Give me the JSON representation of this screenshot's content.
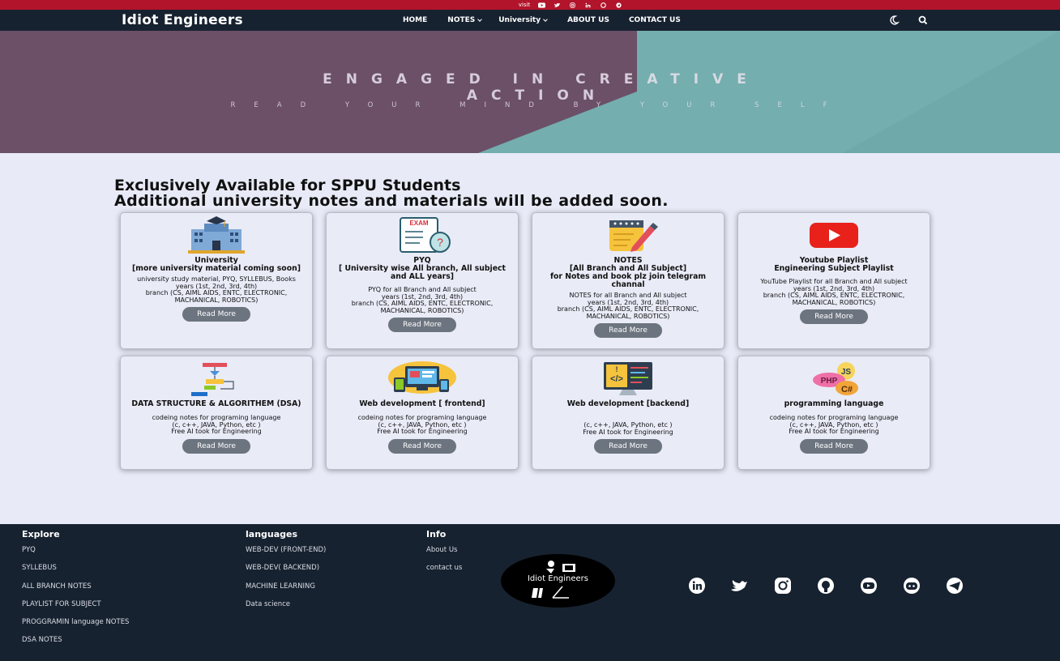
{
  "topbar": {
    "visit_label": "visit",
    "icons": [
      "youtube-icon",
      "twitter-icon",
      "instagram-icon",
      "linkedin-icon",
      "github-icon",
      "telegram-icon"
    ]
  },
  "nav": {
    "brand": "Idiot Engineers",
    "items": [
      {
        "label": "HOME",
        "dropdown": false
      },
      {
        "label": "NOTES",
        "dropdown": true
      },
      {
        "label": "University",
        "dropdown": true
      },
      {
        "label": "ABOUT US",
        "dropdown": false
      },
      {
        "label": "CONTACT US",
        "dropdown": false
      }
    ],
    "icons": [
      "moon-icon",
      "search-icon"
    ]
  },
  "hero": {
    "title_line1": "ENGAGED IN CREATIVE",
    "title_line2": "ACTION",
    "subtitle": "READ YOUR MIND BY YOUR SELF"
  },
  "heading": {
    "line1": "Exclusively Available for SPPU Students",
    "line2": "Additional university notes and materials will be added soon."
  },
  "cards": [
    {
      "icon": "university-icon",
      "title": "University\n[more university material coming soon]",
      "desc": "university study material, PYQ, SYLLEBUS, Books\nyears (1st, 2nd, 3rd, 4th)\nbranch (CS, AIML AIDS, ENTC, ELECTRONIC, MACHANICAL, ROBOTICS)",
      "button": "Read More"
    },
    {
      "icon": "exam-icon",
      "title": "PYQ\n[ University wise All branch, All subject\nand ALL years]",
      "desc": "PYQ for all Branch and All subject\nyears (1st, 2nd, 3rd, 4th)\nbranch (CS, AIML AIDS, ENTC, ELECTRONIC, MACHANICAL, ROBOTICS)",
      "button": "Read More"
    },
    {
      "icon": "notes-icon",
      "title": "NOTES\n[All Branch and All Subject]\nfor Notes and book plz join telegram channal",
      "desc": "NOTES for all Branch and All subject\nyears (1st, 2nd, 3rd, 4th)\nbranch (CS, AIML AIDS, ENTC, ELECTRONIC, MACHANICAL, ROBOTICS)",
      "button": "Read More"
    },
    {
      "icon": "youtube-icon",
      "title": "Youtube Playlist\nEngineering Subject Playlist",
      "desc": "YouTube Playlist for all Branch and All subject\nyears (1st, 2nd, 3rd, 4th)\nbranch (CS, AIML AIDS, ENTC, ELECTRONIC, MACHANICAL, ROBOTICS)",
      "button": "Read More"
    },
    {
      "icon": "flowchart-icon",
      "title": "DATA STRUCTURE & ALGORITHEM (DSA)",
      "desc": "codeing notes for programing language\n(c, c++, JAVA, Python, etc )\nFree AI took for Engineering",
      "button": "Read More"
    },
    {
      "icon": "web-devices-icon",
      "title": "Web development [ frontend]",
      "desc": "codeing notes for programing language\n(c, c++, JAVA, Python, etc )\nFree AI took for Engineering",
      "button": "Read More"
    },
    {
      "icon": "code-monitor-icon",
      "title": "Web development [backend]",
      "desc": "(c, c++, JAVA, Python, etc )\nFree AI took for Engineering",
      "button": "Read More"
    },
    {
      "icon": "languages-icon",
      "title": "programming language",
      "desc": "codeing notes for programing language\n(c, c++, JAVA, Python, etc )\nFree AI took for Engineering",
      "button": "Read More"
    }
  ],
  "card_art": {
    "exam_label": "EXAM",
    "js": "JS",
    "php": "PHP",
    "csharp": "C#"
  },
  "footer": {
    "explore": {
      "heading": "Explore",
      "links": [
        "PYQ",
        "SYLLEBUS",
        "ALL BRANCH NOTES",
        "PLAYLIST FOR SUBJECT",
        "PROGGRAMIN language NOTES",
        "DSA NOTES"
      ]
    },
    "languages": {
      "heading": "languages",
      "links": [
        "WEB-DEV (FRONT-END)",
        "WEB-DEV( BACKEND)",
        "MACHINE LEARNING",
        "Data science"
      ]
    },
    "info": {
      "heading": "Info",
      "links": [
        "About Us",
        "contact us"
      ]
    },
    "logo_text": "Idiot Engineers",
    "socials": [
      "linkedin-icon",
      "twitter-icon",
      "instagram-icon",
      "github-icon",
      "youtube-icon",
      "discord-icon",
      "telegram-icon"
    ]
  },
  "colors": {
    "topbar": "#b1142b",
    "nav": "#172230",
    "hero_left": "#6b5068",
    "hero_right": "#7bb3b3",
    "page_bg": "#e8ebf7",
    "button": "#6c747f",
    "footer": "#172230"
  }
}
